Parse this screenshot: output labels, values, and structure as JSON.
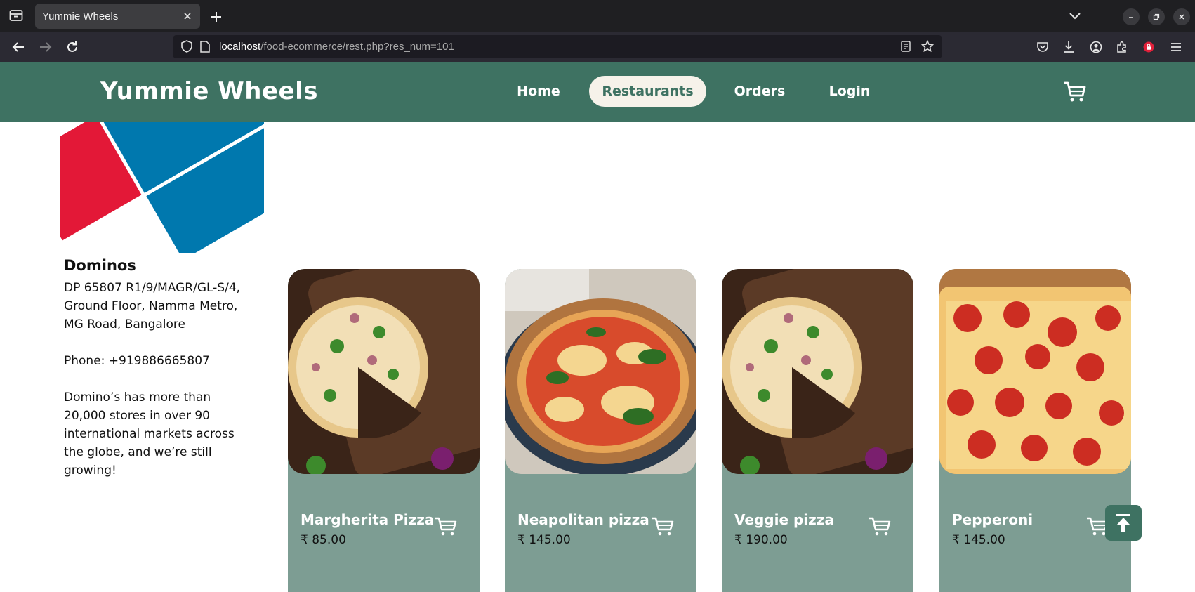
{
  "browser": {
    "tab_title": "Yummie Wheels",
    "url_host": "localhost",
    "url_path": "/food-ecommerce/rest.php?res_num=101"
  },
  "site": {
    "brand": "Yummie Wheels",
    "nav": [
      {
        "label": "Home"
      },
      {
        "label": "Restaurants"
      },
      {
        "label": "Orders"
      },
      {
        "label": "Login"
      }
    ],
    "active_nav": "Restaurants",
    "accent": "#3e7262"
  },
  "restaurant": {
    "name": "Dominos",
    "logo_text": "Domino's Pizza",
    "address_lines": [
      "DP 65807 R1/9/MAGR/GL-S/4,",
      "Ground Floor, Namma Metro,",
      "MG Road, Bangalore"
    ],
    "phone": "Phone: +919886665807",
    "description_lines": [
      "Domino’s has more than",
      "20,000 stores in over 90",
      "international markets across",
      "the globe, and we’re still",
      "growing!"
    ]
  },
  "menu": [
    {
      "name": "Margherita Pizza",
      "price": "₹ 85.00",
      "image": "pizza-on-board"
    },
    {
      "name": "Neapolitan pizza",
      "price": "₹ 145.00",
      "image": "neapolitan-pizza"
    },
    {
      "name": "Veggie pizza",
      "price": "₹ 190.00",
      "image": "pizza-on-board"
    },
    {
      "name": "Pepperoni",
      "price": "₹ 145.00",
      "image": "pepperoni-pizza"
    }
  ]
}
